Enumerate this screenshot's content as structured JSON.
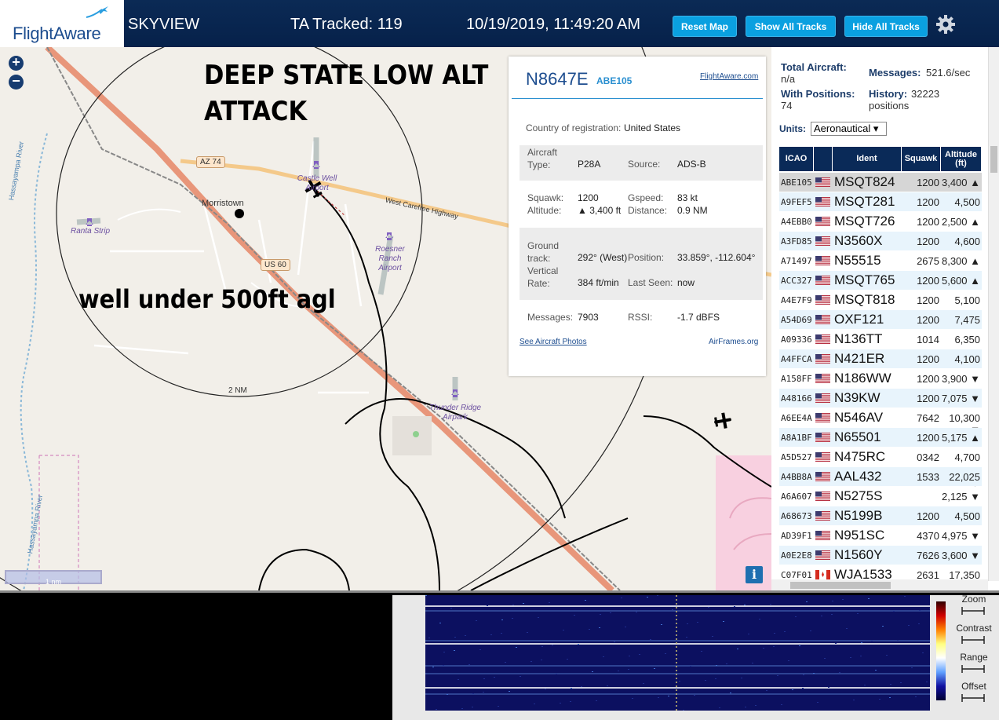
{
  "header": {
    "logo_text": "FlightAware",
    "app_name": "SKYVIEW",
    "ta_tracked": "TA Tracked: 119",
    "datetime": "10/19/2019, 11:49:20 AM",
    "buttons": {
      "reset_map": "Reset Map",
      "show_all_tracks": "Show All Tracks",
      "hide_all_tracks": "Hide All Tracks"
    },
    "accent_color": "#0aa0e0",
    "bg_color": "#06214a"
  },
  "map": {
    "zoom_in": "+",
    "zoom_out": "−",
    "overlay_title_line1": "DEEP STATE LOW ALT",
    "overlay_title_line2": "ATTACK",
    "overlay_note": "well under 500ft agl",
    "range_ring_label": "2 NM",
    "scale_label": "1 nm",
    "info_button": "i",
    "places": {
      "town": "Morristown"
    },
    "roads": {
      "az74": "AZ 74",
      "us60": "US 60",
      "west_carefree": "West Carefree Highway"
    },
    "rivers": {
      "river_a": "Hassayampa River",
      "river_b": "Hassayampa River"
    },
    "airports": {
      "castle_well": "Castle Well Airport",
      "ranta": "Ranta Strip",
      "roesner": "Roesner Ranch Airport",
      "thunder_ridge": "Thunder Ridge Airpark"
    }
  },
  "popup": {
    "registration": "N8647E",
    "flight": "ABE105",
    "fa_link": "FlightAware.com",
    "country_label": "Country of registration:",
    "country_value": "United States",
    "aircraft_type_label": "Aircraft Type:",
    "aircraft_type_value": "P28A",
    "source_label": "Source:",
    "source_value": "ADS-B",
    "squawk_label": "Squawk:",
    "squawk_value": "1200",
    "gspeed_label": "Gspeed:",
    "gspeed_value": "83 kt",
    "altitude_label": "Altitude:",
    "altitude_value": "▲ 3,400 ft",
    "distance_label": "Distance:",
    "distance_value": "0.9 NM",
    "ground_track_label": "Ground track:",
    "ground_track_value": "292° (West)",
    "position_label": "Position:",
    "position_value": "33.859°, -112.604°",
    "vrate_label": "Vertical Rate:",
    "vrate_value": "384 ft/min",
    "last_seen_label": "Last Seen:",
    "last_seen_value": "now",
    "messages_label": "Messages:",
    "messages_value": "7903",
    "rssi_label": "RSSI:",
    "rssi_value": "-1.7 dBFS",
    "photos_link": "See Aircraft Photos",
    "airframes_link": "AirFrames.org"
  },
  "sidebar": {
    "total_aircraft_label": "Total Aircraft:",
    "total_aircraft_value": "n/a",
    "messages_label": "Messages:",
    "messages_value": "521.6/sec",
    "with_positions_label": "With Positions:",
    "with_positions_value": "74",
    "history_label": "History:",
    "history_value": "32223",
    "history_unit": "positions",
    "units_label": "Units:",
    "units_value": "Aeronautical ▾",
    "columns": [
      "ICAO",
      "Ident",
      "Squawk",
      "Altitude (ft)"
    ],
    "rows": [
      {
        "icao": "ABE105",
        "flag": "us",
        "ident": "MSQT824",
        "squawk": "1200",
        "alt": "3,400 ▲"
      },
      {
        "icao": "A9FEF5",
        "flag": "us",
        "ident": "MSQT281",
        "squawk": "1200",
        "alt": "4,500"
      },
      {
        "icao": "A4EBB0",
        "flag": "us",
        "ident": "MSQT726",
        "squawk": "1200",
        "alt": "2,500 ▲"
      },
      {
        "icao": "A3FD85",
        "flag": "us",
        "ident": "N3560X",
        "squawk": "1200",
        "alt": "4,600"
      },
      {
        "icao": "A71497",
        "flag": "us",
        "ident": "N55515",
        "squawk": "2675",
        "alt": "8,300 ▲"
      },
      {
        "icao": "ACC327",
        "flag": "us",
        "ident": "MSQT765",
        "squawk": "1200",
        "alt": "5,600 ▲"
      },
      {
        "icao": "A4E7F9",
        "flag": "us",
        "ident": "MSQT818",
        "squawk": "1200",
        "alt": "5,100"
      },
      {
        "icao": "A54D69",
        "flag": "us",
        "ident": "OXF121",
        "squawk": "1200",
        "alt": "7,475"
      },
      {
        "icao": "A09336",
        "flag": "us",
        "ident": "N136TT",
        "squawk": "1014",
        "alt": "6,350"
      },
      {
        "icao": "A4FFCA",
        "flag": "us",
        "ident": "N421ER",
        "squawk": "1200",
        "alt": "4,100"
      },
      {
        "icao": "A158FF",
        "flag": "us",
        "ident": "N186WW",
        "squawk": "1200",
        "alt": "3,900 ▼"
      },
      {
        "icao": "A48166",
        "flag": "us",
        "ident": "N39KW",
        "squawk": "1200",
        "alt": "7,075 ▼"
      },
      {
        "icao": "A6EE4A",
        "flag": "us",
        "ident": "N546AV",
        "squawk": "7642",
        "alt": "10,300 ▼"
      },
      {
        "icao": "A8A1BF",
        "flag": "us",
        "ident": "N65501",
        "squawk": "1200",
        "alt": "5,175 ▲"
      },
      {
        "icao": "A5D527",
        "flag": "us",
        "ident": "N475RC",
        "squawk": "0342",
        "alt": "4,700"
      },
      {
        "icao": "A4BB8A",
        "flag": "us",
        "ident": "AAL432",
        "squawk": "1533",
        "alt": "22,025 ▲"
      },
      {
        "icao": "A6A607",
        "flag": "us",
        "ident": "N5275S",
        "squawk": "",
        "alt": "2,125 ▼"
      },
      {
        "icao": "A68673",
        "flag": "us",
        "ident": "N5199B",
        "squawk": "1200",
        "alt": "4,500"
      },
      {
        "icao": "AD39F1",
        "flag": "us",
        "ident": "N951SC",
        "squawk": "4370",
        "alt": "4,975 ▼"
      },
      {
        "icao": "A0E2E8",
        "flag": "us",
        "ident": "N1560Y",
        "squawk": "7626",
        "alt": "3,600 ▼"
      },
      {
        "icao": "C07F01",
        "flag": "ca",
        "ident": "WJA1533",
        "squawk": "2631",
        "alt": "17,350 ▲"
      }
    ]
  },
  "waterfall": {
    "controls": [
      "Zoom",
      "Contrast",
      "Range",
      "Offset"
    ]
  }
}
